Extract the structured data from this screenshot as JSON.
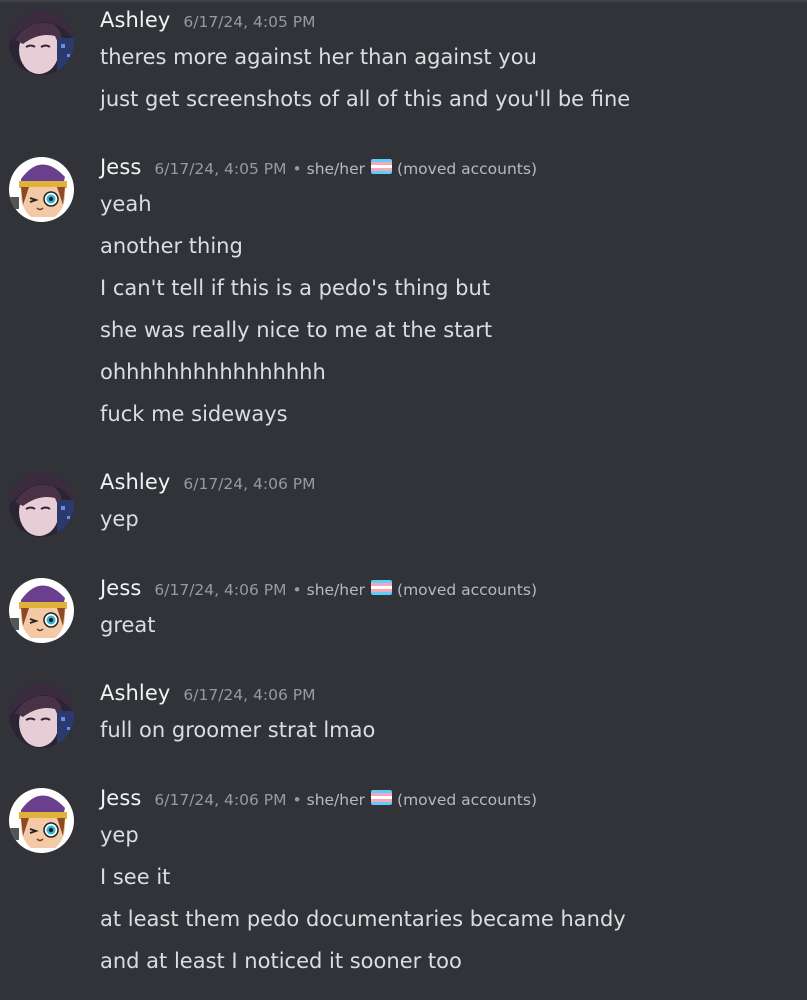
{
  "colors": {
    "background": "#313338",
    "username": "#f2f3f5",
    "timestamp": "#949ba4",
    "message_text": "#dbdee1",
    "trans_flag": [
      "#5bcefa",
      "#f5a9b8",
      "#ffffff",
      "#f5a9b8",
      "#5bcefa"
    ]
  },
  "messages": [
    {
      "author": "Ashley",
      "avatar_icon": "ashley-avatar-icon",
      "timestamp": "6/17/24, 4:05 PM",
      "lines": [
        "theres more against her than against you",
        "just get screenshots of all of this and you'll be fine"
      ]
    },
    {
      "author": "Jess",
      "avatar_icon": "jess-avatar-icon",
      "timestamp": "6/17/24, 4:05 PM",
      "separator": "•",
      "pronouns": "she/her",
      "flag_icon": "trans-flag-icon",
      "tag": "(moved accounts)",
      "lines": [
        "yeah",
        "another thing",
        "I can't tell if this is a pedo's thing but",
        "she was really nice to me at the start",
        "ohhhhhhhhhhhhhhhh",
        "fuck me sideways"
      ]
    },
    {
      "author": "Ashley",
      "avatar_icon": "ashley-avatar-icon",
      "timestamp": "6/17/24, 4:06 PM",
      "lines": [
        "yep"
      ]
    },
    {
      "author": "Jess",
      "avatar_icon": "jess-avatar-icon",
      "timestamp": "6/17/24, 4:06 PM",
      "separator": "•",
      "pronouns": "she/her",
      "flag_icon": "trans-flag-icon",
      "tag": "(moved accounts)",
      "lines": [
        "great"
      ]
    },
    {
      "author": "Ashley",
      "avatar_icon": "ashley-avatar-icon",
      "timestamp": "6/17/24, 4:06 PM",
      "lines": [
        "full on groomer strat lmao"
      ]
    },
    {
      "author": "Jess",
      "avatar_icon": "jess-avatar-icon",
      "timestamp": "6/17/24, 4:06 PM",
      "separator": "•",
      "pronouns": "she/her",
      "flag_icon": "trans-flag-icon",
      "tag": "(moved accounts)",
      "lines": [
        "yep",
        "I see it",
        "at least them pedo documentaries became handy",
        "and at least I noticed it sooner too"
      ]
    }
  ]
}
